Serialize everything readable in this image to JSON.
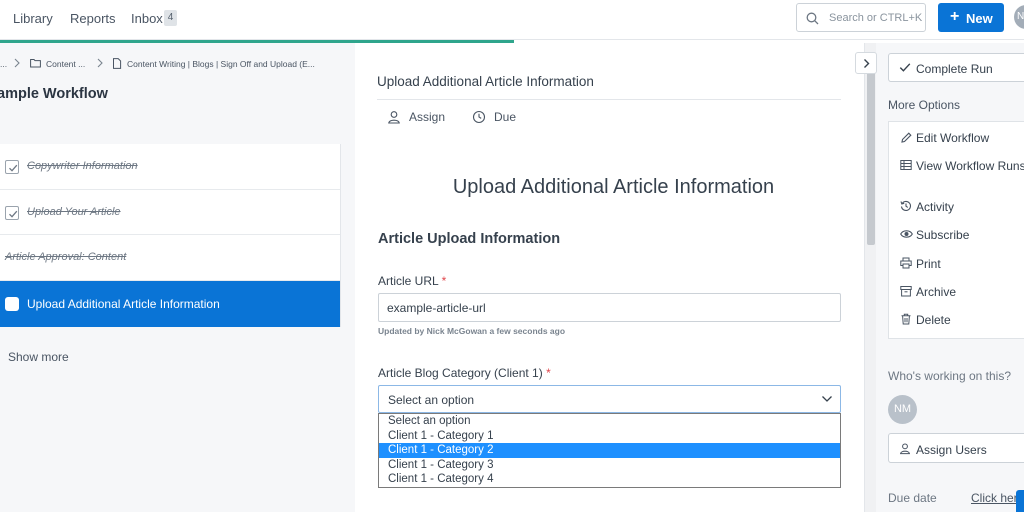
{
  "nav": {
    "library": "Library",
    "reports": "Reports",
    "inbox": "Inbox",
    "inbox_count": "4",
    "search_placeholder": "Search or CTRL+K",
    "new_button": "New",
    "user_initials": "NM"
  },
  "breadcrumb": {
    "ellipsis": "...",
    "folder": "Content ...",
    "template": "Content Writing | Blogs | Sign Off and Upload (E..."
  },
  "workflow_title": "ample Workflow",
  "tasks": [
    {
      "label": "Copywriter Information",
      "status": "completed"
    },
    {
      "label": "Upload Your Article",
      "status": "completed"
    },
    {
      "label": "Article Approval: Content",
      "status": "completed"
    },
    {
      "label": "Upload Additional Article Information",
      "status": "active"
    }
  ],
  "show_more": "Show more",
  "main": {
    "task_header": "Upload Additional Article Information",
    "assign": "Assign",
    "due": "Due",
    "form_title": "Upload Additional Article Information",
    "section_heading": "Article Upload Information",
    "url_label": "Article URL",
    "url_value": "example-article-url",
    "url_updated_note": "Updated by Nick McGowan a few seconds ago",
    "category_label": "Article Blog Category (Client 1)",
    "required_mark": "*",
    "category_selected": "Select an option",
    "category_options": [
      "Select an option",
      "Client 1 - Category 1",
      "Client 1 - Category 2",
      "Client 1 - Category 3",
      "Client 1 - Category 4"
    ],
    "category_highlighted_index": 2
  },
  "sidebar_right": {
    "complete_run": "Complete Run",
    "more_options": "More Options",
    "options": [
      "Edit Workflow",
      "View Workflow Runs",
      "Activity",
      "Subscribe",
      "Print",
      "Archive",
      "Delete"
    ],
    "who_working": "Who's working on this?",
    "avatar_initials": "NM",
    "assign_users": "Assign Users",
    "due_date": "Due date",
    "click_here": "Click here"
  },
  "colors": {
    "primary": "#0a74d6",
    "progress": "#2fa58c",
    "required": "#e0464b",
    "dropdown_highlight": "#1e90ff"
  }
}
